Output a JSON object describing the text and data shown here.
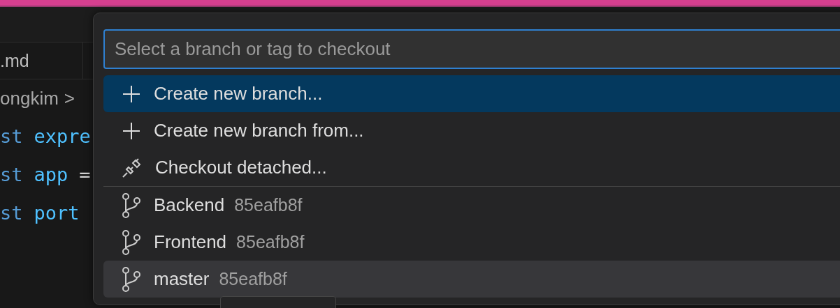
{
  "editor": {
    "tab": {
      "label": ".md"
    },
    "breadcrumb": {
      "text": "ongkim",
      "separator": ">"
    },
    "code_lines": [
      {
        "tokens": [
          {
            "kind": "keyword",
            "text": "st"
          },
          {
            "kind": "variable",
            "text": "expre"
          }
        ]
      },
      {
        "tokens": [
          {
            "kind": "keyword",
            "text": "st"
          },
          {
            "kind": "variable",
            "text": "app"
          },
          {
            "kind": "operator",
            "text": "="
          }
        ]
      },
      {
        "tokens": [
          {
            "kind": "keyword",
            "text": "st"
          },
          {
            "kind": "variable",
            "text": "port"
          }
        ]
      }
    ]
  },
  "quick_pick": {
    "input": {
      "placeholder": "Select a branch or tag to checkout"
    },
    "actions": [
      {
        "kind": "create",
        "label": "Create new branch...",
        "selected": true
      },
      {
        "kind": "create",
        "label": "Create new branch from...",
        "selected": false
      },
      {
        "kind": "detach",
        "label": "Checkout detached...",
        "selected": false
      }
    ],
    "branches": [
      {
        "kind": "branch",
        "label": "Backend",
        "commit": "85eafb8f",
        "hovered": false
      },
      {
        "kind": "branch",
        "label": "Frontend",
        "commit": "85eafb8f",
        "hovered": false
      },
      {
        "kind": "branch",
        "label": "master",
        "commit": "85eafb8f",
        "hovered": true
      }
    ]
  }
}
